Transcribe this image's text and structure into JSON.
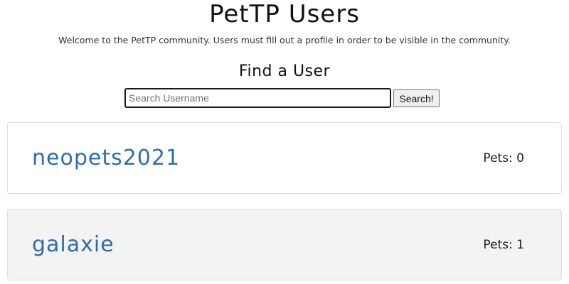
{
  "header": {
    "title": "PetTP Users",
    "welcome_text": "Welcome to the PetTP community. Users must fill out a profile in order to be visible in the community."
  },
  "search": {
    "heading": "Find a User",
    "placeholder": "Search Username",
    "value": "",
    "button_label": "Search!"
  },
  "users": [
    {
      "username": "neopets2021",
      "pets_label": "Pets: 0"
    },
    {
      "username": "galaxie",
      "pets_label": "Pets: 1"
    }
  ],
  "colors": {
    "username_link": "#2f6ea5",
    "card_border": "#dedede",
    "alt_card_background": "#f3f3f3"
  }
}
